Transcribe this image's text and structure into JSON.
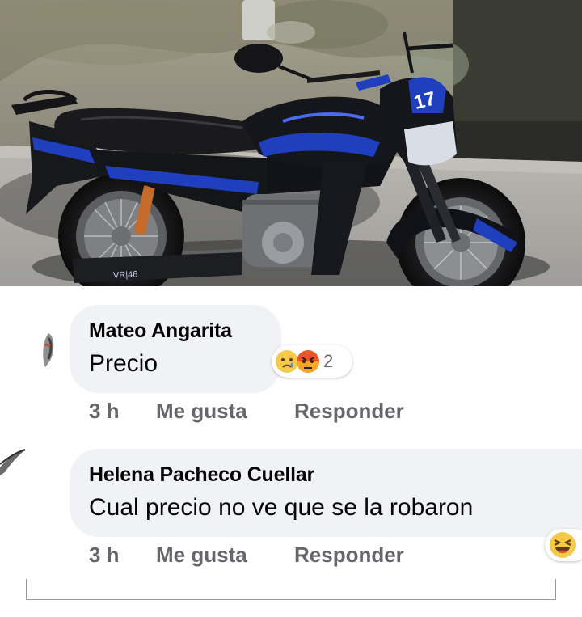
{
  "photo": {
    "alt": "",
    "decal_text": "VR|46"
  },
  "comments": [
    {
      "author": "Mateo Angarita",
      "text": "Precio",
      "time": "3 h",
      "like_label": "Me gusta",
      "reply_label": "Responder",
      "reactions": {
        "icons": [
          "sad-face",
          "angry-face"
        ],
        "count": "2"
      }
    },
    {
      "author": "Helena Pacheco Cuellar",
      "text": "Cual precio no ve que se la robaron",
      "time": "3 h",
      "like_label": "Me gusta",
      "reply_label": "Responder",
      "reactions": {
        "icons": [
          "laughing-face"
        ]
      }
    }
  ],
  "colors": {
    "bubble": "#f0f2f5",
    "meta_text": "#65676b",
    "bike_blue": "#1f3fbf"
  }
}
